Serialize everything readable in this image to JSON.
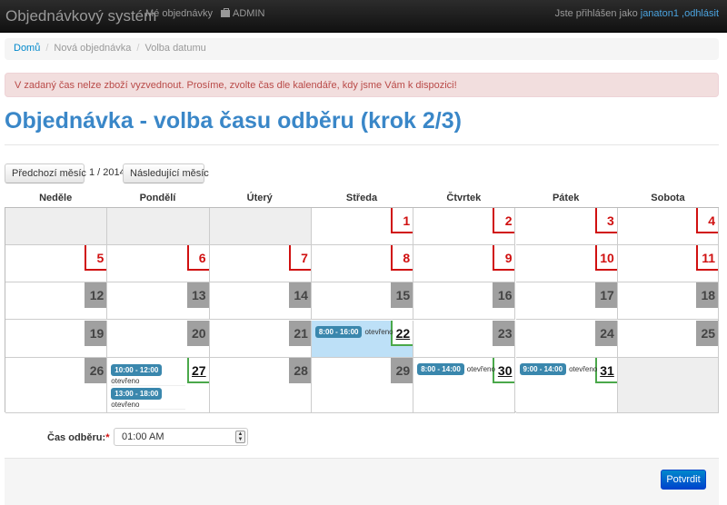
{
  "navbar": {
    "brand": "Objednávkový systém",
    "links": [
      "Mé objednávky",
      "ADMIN"
    ],
    "user_prefix": "Jste přihlášen jako ",
    "user_name": "janaton1",
    "logout": " ,odhlásit"
  },
  "breadcrumb": [
    "Domů",
    "Nová objednávka",
    "Volba datumu"
  ],
  "alert": "V zadaný čas nelze zboží vyzvednout. Prosíme, zvolte čas dle kalendáře, kdy jsme Vám k dispozici!",
  "title": "Objednávka - volba času odběru (krok 2/3)",
  "calendar": {
    "prev_label": "Předchozí měsíc",
    "month": "1 / 2014",
    "next_label": "Následující měsíc",
    "weekdays": [
      "Neděle",
      "Pondělí",
      "Úterý",
      "Středa",
      "Čtvrtek",
      "Pátek",
      "Sobota"
    ],
    "weeks": [
      [
        null,
        null,
        null,
        {
          "day": "1",
          "status": "closed"
        },
        {
          "day": "2",
          "status": "closed"
        },
        {
          "day": "3",
          "status": "closed"
        },
        {
          "day": "4",
          "status": "closed"
        }
      ],
      [
        {
          "day": "5",
          "status": "closed"
        },
        {
          "day": "6",
          "status": "closed"
        },
        {
          "day": "7",
          "status": "closed"
        },
        {
          "day": "8",
          "status": "closed"
        },
        {
          "day": "9",
          "status": "closed"
        },
        {
          "day": "10",
          "status": "closed"
        },
        {
          "day": "11",
          "status": "closed"
        }
      ],
      [
        {
          "day": "12",
          "status": "past"
        },
        {
          "day": "13",
          "status": "past"
        },
        {
          "day": "14",
          "status": "past"
        },
        {
          "day": "15",
          "status": "past"
        },
        {
          "day": "16",
          "status": "past"
        },
        {
          "day": "17",
          "status": "past"
        },
        {
          "day": "18",
          "status": "past"
        }
      ],
      [
        {
          "day": "19",
          "status": "past"
        },
        {
          "day": "20",
          "status": "past"
        },
        {
          "day": "21",
          "status": "past"
        },
        {
          "day": "22",
          "status": "open",
          "selected": true,
          "slots": [
            {
              "time": "8:00 - 16:00",
              "state": "otevřeno"
            }
          ]
        },
        {
          "day": "23",
          "status": "past"
        },
        {
          "day": "24",
          "status": "past"
        },
        {
          "day": "25",
          "status": "past"
        }
      ],
      [
        {
          "day": "26",
          "status": "past"
        },
        {
          "day": "27",
          "status": "open",
          "slots": [
            {
              "time": "10:00 - 12:00",
              "state": "otevřeno"
            },
            {
              "time": "13:00 - 18:00",
              "state": "otevřeno"
            }
          ]
        },
        {
          "day": "28",
          "status": "past"
        },
        {
          "day": "29",
          "status": "past"
        },
        {
          "day": "30",
          "status": "open",
          "slots": [
            {
              "time": "8:00 - 14:00",
              "state": "otevřeno"
            }
          ]
        },
        {
          "day": "31",
          "status": "open",
          "slots": [
            {
              "time": "9:00 - 14:00",
              "state": "otevřeno"
            }
          ]
        },
        null
      ]
    ]
  },
  "form": {
    "label": "Čas odběru:",
    "required_mark": "*",
    "time_value": "01:00 AM",
    "submit": "Potvrdit"
  }
}
